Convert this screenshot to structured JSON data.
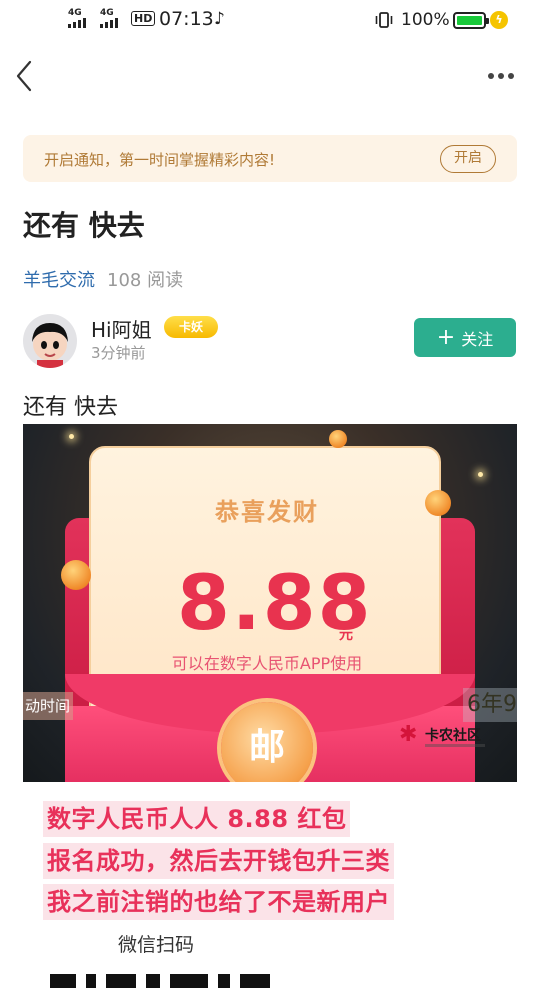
{
  "status_bar": {
    "network_1": "4G",
    "network_2": "4G",
    "hd_label": "HD",
    "time": "07:13",
    "battery": "100%"
  },
  "notify": {
    "text": "开启通知，第一时间掌握精彩内容!",
    "button": "开启"
  },
  "post": {
    "title": "还有 快去",
    "category": "羊毛交流",
    "reads": "108 阅读",
    "author": "Hi阿姐",
    "author_badge": "卡妖",
    "time_ago": "3分钟前",
    "follow_label": "关注",
    "body": "还有 快去"
  },
  "image": {
    "card_title": "恭喜发财",
    "amount": "8.88",
    "unit": "元",
    "subtitle": "可以在数字人民币APP使用",
    "seal_char": "邮",
    "side_left": "动时间",
    "side_right": "6年9",
    "logo_text": "卡农社区"
  },
  "highlights": [
    "数字人民币人人 8.88 红包",
    "报名成功，然后去开钱包升三类",
    "我之前注销的也给了不是新用户"
  ],
  "scan_text": "微信扫码",
  "colors": {
    "accent_green": "#2cae8f",
    "category_blue": "#2f6cad",
    "highlight_red": "#e8315a",
    "notify_brown": "#b07a36"
  }
}
